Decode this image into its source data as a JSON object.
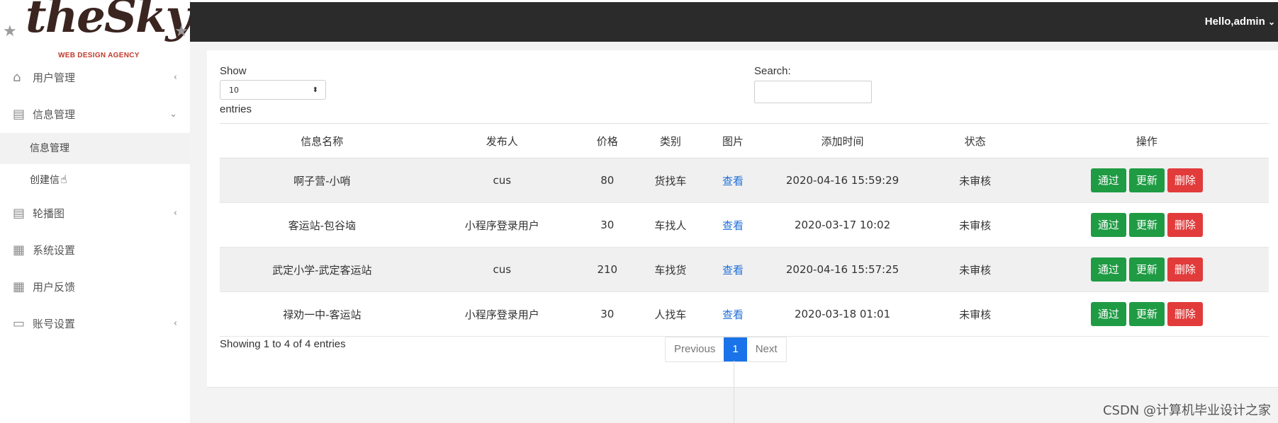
{
  "logo": {
    "brand": "theSky",
    "tagline": "WEB DESIGN AGENCY"
  },
  "header": {
    "user_greeting": "Hello,admin"
  },
  "sidebar": {
    "items": [
      {
        "label": "用户管理",
        "icon": "home-icon",
        "chevron": "‹"
      },
      {
        "label": "信息管理",
        "icon": "document-icon",
        "chevron": "⌄"
      },
      {
        "label": "信息管理",
        "sub": true
      },
      {
        "label": "创建信",
        "sub": true
      },
      {
        "label": "轮播图",
        "icon": "document-icon",
        "chevron": "‹"
      },
      {
        "label": "系统设置",
        "icon": "grid-icon"
      },
      {
        "label": "用户反馈",
        "icon": "grid-icon"
      },
      {
        "label": "账号设置",
        "icon": "folder-icon",
        "chevron": "‹"
      }
    ]
  },
  "table_controls": {
    "show_label": "Show",
    "page_length": "10",
    "entries_label": "entries",
    "search_label": "Search:",
    "search_value": ""
  },
  "table": {
    "headers": [
      "信息名称",
      "发布人",
      "价格",
      "类别",
      "图片",
      "添加时间",
      "状态",
      "操作"
    ],
    "rows": [
      {
        "name": "啊子营-小哨",
        "publisher": "cus",
        "price": "80",
        "category": "货找车",
        "image": "查看",
        "added": "2020-04-16 15:59:29",
        "status": "未审核"
      },
      {
        "name": "客运站-包谷垴",
        "publisher": "小程序登录用户",
        "price": "30",
        "category": "车找人",
        "image": "查看",
        "added": "2020-03-17 10:02",
        "status": "未审核"
      },
      {
        "name": "武定小学-武定客运站",
        "publisher": "cus",
        "price": "210",
        "category": "车找货",
        "image": "查看",
        "added": "2020-04-16 15:57:25",
        "status": "未审核"
      },
      {
        "name": "禄劝一中-客运站",
        "publisher": "小程序登录用户",
        "price": "30",
        "category": "人找车",
        "image": "查看",
        "added": "2020-03-18 01:01",
        "status": "未审核"
      }
    ],
    "actions": {
      "approve": "通过",
      "update": "更新",
      "delete": "删除"
    }
  },
  "footer": {
    "info": "Showing 1 to 4 of 4 entries",
    "previous": "Previous",
    "page": "1",
    "next": "Next"
  },
  "watermark": "CSDN @计算机毕业设计之家",
  "colors": {
    "topbar": "#2b2b2b",
    "approve": "#1f9b44",
    "delete": "#e23b3b",
    "active_page": "#1a73e8",
    "link": "#1e6fd9"
  }
}
